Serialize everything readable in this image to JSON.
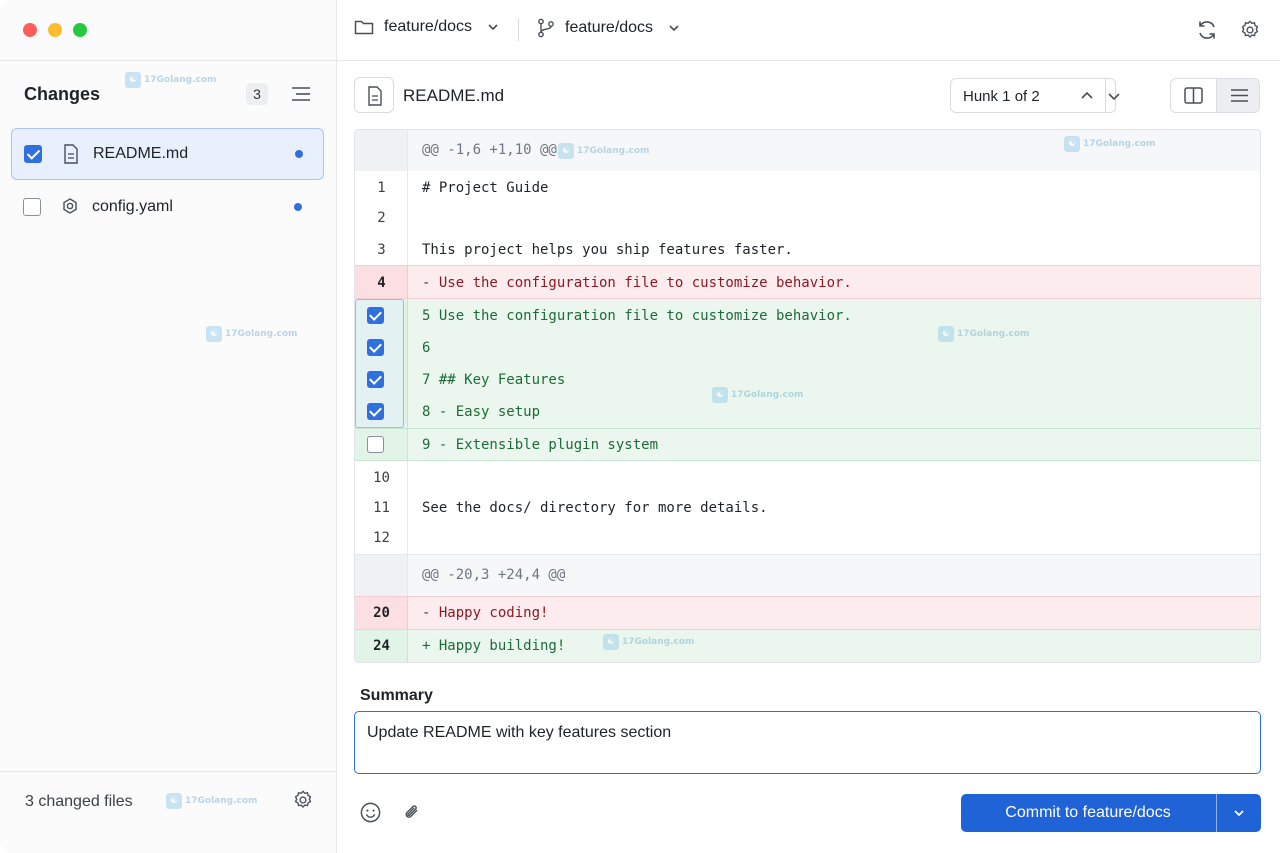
{
  "window": {
    "traffic_lights": [
      "close",
      "minimize",
      "maximize"
    ]
  },
  "sidebar": {
    "title": "Changes",
    "count": "3",
    "files": [
      {
        "name": "README.md",
        "checked": true,
        "icon": "document-icon"
      },
      {
        "name": "config.yaml",
        "checked": false,
        "icon": "gear-file-icon"
      }
    ],
    "footer_label": "3 changed files"
  },
  "topbar": {
    "repo": "feature/docs",
    "branch": "feature/docs"
  },
  "file_header": {
    "title": "README.md",
    "hunk_label": "Hunk 1 of 2"
  },
  "diff": {
    "hunk1_header": "@@ -1,6 +1,10 @@",
    "lines": [
      {
        "num": "1",
        "code": "# Project Guide"
      },
      {
        "num": "2",
        "code": ""
      },
      {
        "num": "3",
        "code": "This project helps you ship features faster."
      },
      {
        "num": "4",
        "code": "- Use the configuration file to customize behavior."
      },
      {
        "num": "",
        "code": "5 Use the configuration file to customize behavior."
      },
      {
        "num": "",
        "code": "6"
      },
      {
        "num": "",
        "code": "7 ## Key Features"
      },
      {
        "num": "",
        "code": "8 - Easy setup"
      },
      {
        "num": "",
        "code": "9 - Extensible plugin system"
      },
      {
        "num": "10",
        "code": ""
      },
      {
        "num": "11",
        "code": "See the docs/ directory for more details."
      },
      {
        "num": "12",
        "code": ""
      }
    ],
    "hunk2_header": "@@ -20,3 +24,4 @@",
    "hunk2_lines": [
      {
        "num": "20",
        "code": "- Happy coding!"
      },
      {
        "num": "24",
        "code": "+ Happy building!"
      }
    ]
  },
  "summary": {
    "label": "Summary",
    "value": "Update README with key features section"
  },
  "commit": {
    "label": "Commit to feature/docs"
  },
  "watermark": "17Golang.com",
  "colors": {
    "accent": "#1f63d6",
    "added_bg": "#ebf7ee",
    "removed_bg": "#fdecee"
  }
}
